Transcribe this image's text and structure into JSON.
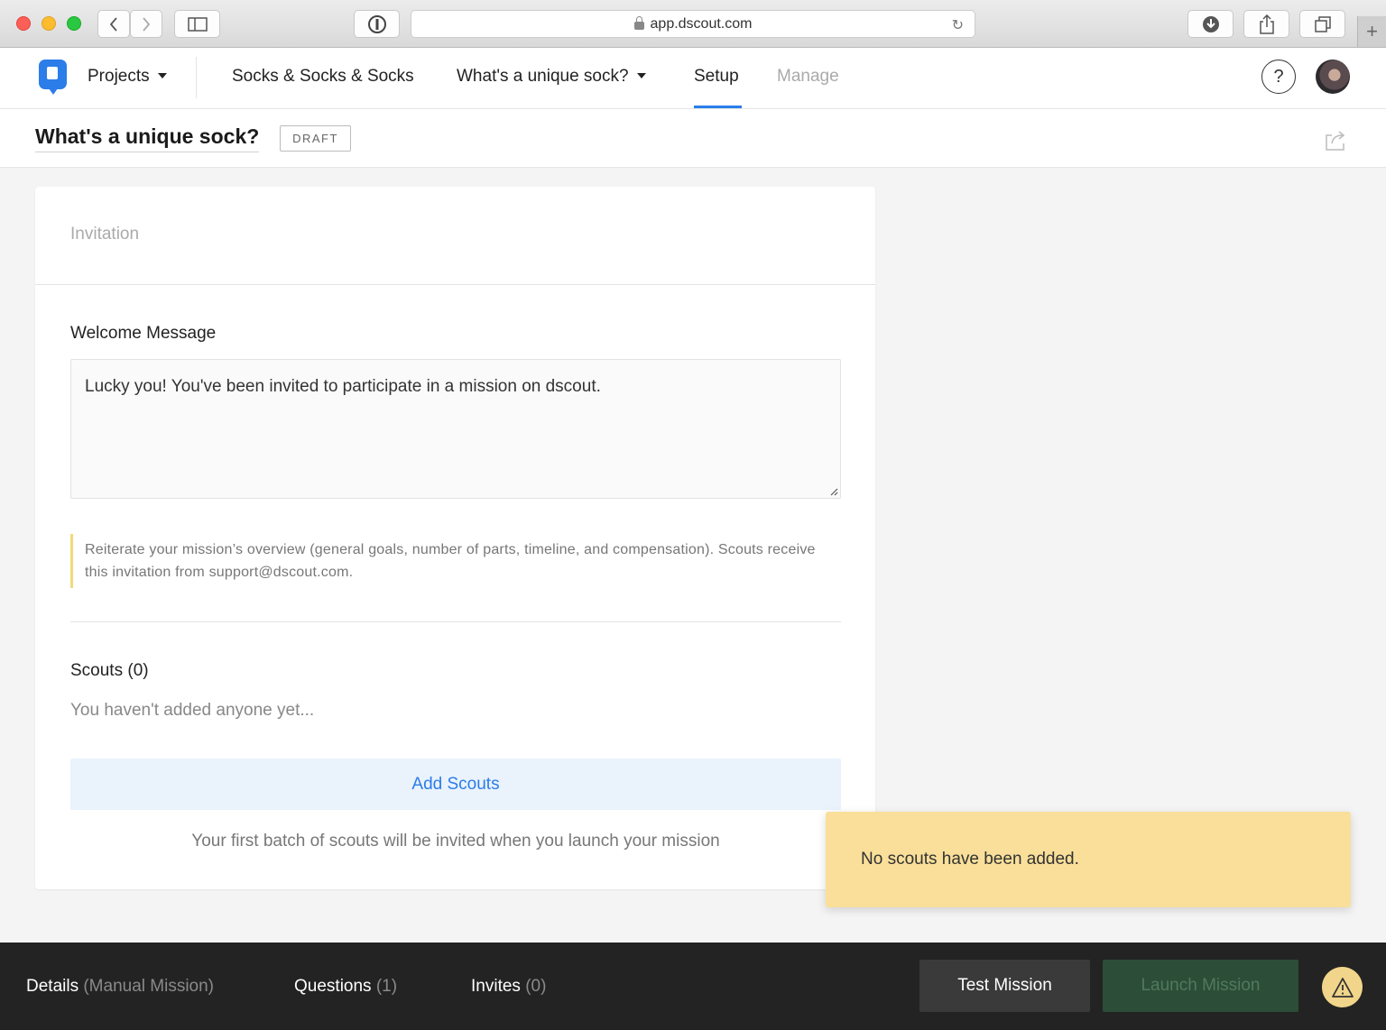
{
  "browser": {
    "url": "app.dscout.com",
    "back_icon": "chevron-left-icon",
    "forward_icon": "chevron-right-icon"
  },
  "nav": {
    "projects_label": "Projects",
    "project_name": "Socks & Socks & Socks",
    "mission_name": "What's a unique sock?",
    "setup_label": "Setup",
    "manage_label": "Manage",
    "help_symbol": "?",
    "accent_color": "#2b7de9"
  },
  "titlebar": {
    "title": "What's a unique sock?",
    "status_badge": "DRAFT"
  },
  "card": {
    "header": "Invitation",
    "welcome_label": "Welcome Message",
    "welcome_value": "Lucky you! You've been invited to participate in a mission on dscout.",
    "hint": "Reiterate your mission’s overview (general goals, number of parts, timeline, and compensation). Scouts receive this invitation from support@dscout.com.",
    "scouts_label": "Scouts (0)",
    "scouts_empty": "You haven't added anyone yet...",
    "add_scouts_label": "Add Scouts",
    "batch_note": "Your first batch of scouts will be invited when you launch your mission"
  },
  "toast": {
    "message": "No scouts have been added.",
    "color": "#f9df99"
  },
  "bottom_bar": {
    "details_label": "Details",
    "details_sub": "(Manual Mission)",
    "questions_label": "Questions",
    "questions_count": "(1)",
    "invites_label": "Invites",
    "invites_count": "(0)",
    "test_label": "Test Mission",
    "launch_label": "Launch Mission",
    "warning_icon": "warning-triangle-icon"
  }
}
